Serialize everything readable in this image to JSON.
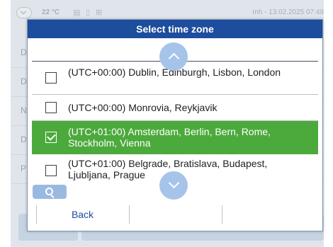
{
  "statusbar": {
    "temperature": "22 °C",
    "icons": [
      "chevron-down-icon",
      "clipboard-icon",
      "cylinder-icon",
      "network-icon"
    ],
    "device_datetime": "mh - 13.02.2025 07:49"
  },
  "background_rows": [
    "D",
    "D",
    "N",
    "D",
    "P"
  ],
  "dialog": {
    "title": "Select time zone",
    "timezones": [
      {
        "label": "(UTC+00:00) Dublin, Edinburgh, Lisbon, London",
        "checked": false
      },
      {
        "label": "(UTC+00:00) Monrovia, Reykjavik",
        "checked": false
      },
      {
        "label": "(UTC+01:00) Amsterdam, Berlin, Bern, Rome, Stockholm, Vienna",
        "checked": true
      },
      {
        "label": "(UTC+01:00) Belgrade, Bratislava, Budapest, Ljubljana, Prague",
        "checked": false
      }
    ],
    "footer": {
      "back_label": "Back"
    }
  },
  "colors": {
    "header": "#1d4d9d",
    "selected": "#4caa3c",
    "scroll_button": "#a6c4ea",
    "search_button": "#9ab9e0"
  }
}
